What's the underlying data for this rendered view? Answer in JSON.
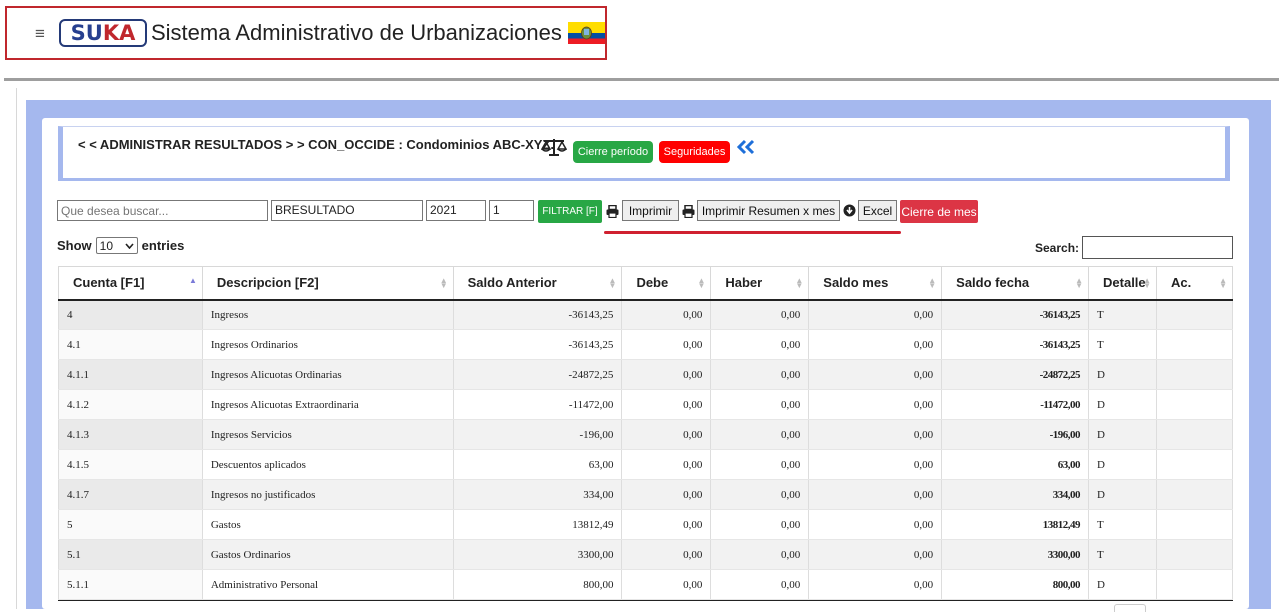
{
  "app": {
    "logo_left": "SU",
    "logo_right": "KA",
    "title": "Sistema Administrativo de Urbanizaciones",
    "menu_icon": "hamburger-icon",
    "flag_icon": "ecuador-flag-icon"
  },
  "header": {
    "title": "< < ADMINISTRAR RESULTADOS > > CON_OCCIDE : Condominios ABC-XYZ.",
    "scale_icon": "balance-scale-icon",
    "cierre_periodo_label": "Cierre período",
    "seguridades_label": "Seguridades",
    "back_icon": "double-chevron-left-icon"
  },
  "filters": {
    "search_placeholder": "Que desea buscar...",
    "module_value": "BRESULTADO",
    "year_value": "2021",
    "period_value": "1",
    "filter_label": "FILTRAR [F]",
    "print_label": "Imprimir",
    "print_summary_label": "Imprimir Resumen x mes",
    "excel_label": "Excel",
    "cierre_mes_label": "Cierre de mes"
  },
  "table_controls": {
    "show_label": "Show",
    "entries_value": "10",
    "entries_label": "entries",
    "search_label": "Search:"
  },
  "table": {
    "columns": [
      "Cuenta [F1]",
      "Descripcion [F2]",
      "Saldo Anterior",
      "Debe",
      "Haber",
      "Saldo mes",
      "Saldo fecha",
      "Detalle",
      "Ac."
    ],
    "rows": [
      {
        "cuenta": "4",
        "descripcion": "Ingresos",
        "saldo_anterior": "-36143,25",
        "debe": "0,00",
        "haber": "0,00",
        "saldo_mes": "0,00",
        "saldo_fecha": "-36143,25",
        "detalle": "T",
        "ac": ""
      },
      {
        "cuenta": "4.1",
        "descripcion": "Ingresos Ordinarios",
        "saldo_anterior": "-36143,25",
        "debe": "0,00",
        "haber": "0,00",
        "saldo_mes": "0,00",
        "saldo_fecha": "-36143,25",
        "detalle": "T",
        "ac": ""
      },
      {
        "cuenta": "4.1.1",
        "descripcion": "Ingresos Alicuotas Ordinarias",
        "saldo_anterior": "-24872,25",
        "debe": "0,00",
        "haber": "0,00",
        "saldo_mes": "0,00",
        "saldo_fecha": "-24872,25",
        "detalle": "D",
        "ac": ""
      },
      {
        "cuenta": "4.1.2",
        "descripcion": "Ingresos Alicuotas Extraordinaria",
        "saldo_anterior": "-11472,00",
        "debe": "0,00",
        "haber": "0,00",
        "saldo_mes": "0,00",
        "saldo_fecha": "-11472,00",
        "detalle": "D",
        "ac": ""
      },
      {
        "cuenta": "4.1.3",
        "descripcion": "Ingresos Servicios",
        "saldo_anterior": "-196,00",
        "debe": "0,00",
        "haber": "0,00",
        "saldo_mes": "0,00",
        "saldo_fecha": "-196,00",
        "detalle": "D",
        "ac": ""
      },
      {
        "cuenta": "4.1.5",
        "descripcion": "Descuentos aplicados",
        "saldo_anterior": "63,00",
        "debe": "0,00",
        "haber": "0,00",
        "saldo_mes": "0,00",
        "saldo_fecha": "63,00",
        "detalle": "D",
        "ac": ""
      },
      {
        "cuenta": "4.1.7",
        "descripcion": "Ingresos no justificados",
        "saldo_anterior": "334,00",
        "debe": "0,00",
        "haber": "0,00",
        "saldo_mes": "0,00",
        "saldo_fecha": "334,00",
        "detalle": "D",
        "ac": ""
      },
      {
        "cuenta": "5",
        "descripcion": "Gastos",
        "saldo_anterior": "13812,49",
        "debe": "0,00",
        "haber": "0,00",
        "saldo_mes": "0,00",
        "saldo_fecha": "13812,49",
        "detalle": "T",
        "ac": ""
      },
      {
        "cuenta": "5.1",
        "descripcion": "Gastos Ordinarios",
        "saldo_anterior": "3300,00",
        "debe": "0,00",
        "haber": "0,00",
        "saldo_mes": "0,00",
        "saldo_fecha": "3300,00",
        "detalle": "T",
        "ac": ""
      },
      {
        "cuenta": "5.1.1",
        "descripcion": "Administrativo Personal",
        "saldo_anterior": "800,00",
        "debe": "0,00",
        "haber": "0,00",
        "saldo_mes": "0,00",
        "saldo_fecha": "800,00",
        "detalle": "D",
        "ac": ""
      }
    ]
  },
  "colors": {
    "accent_blue": "#a5b8ee",
    "green_button": "#28a745",
    "red_button": "#ff0000",
    "cierre_mes_button": "#dc3545",
    "negative_amount": "#1a1ad6",
    "saldo_mes_amount": "#e00000"
  }
}
